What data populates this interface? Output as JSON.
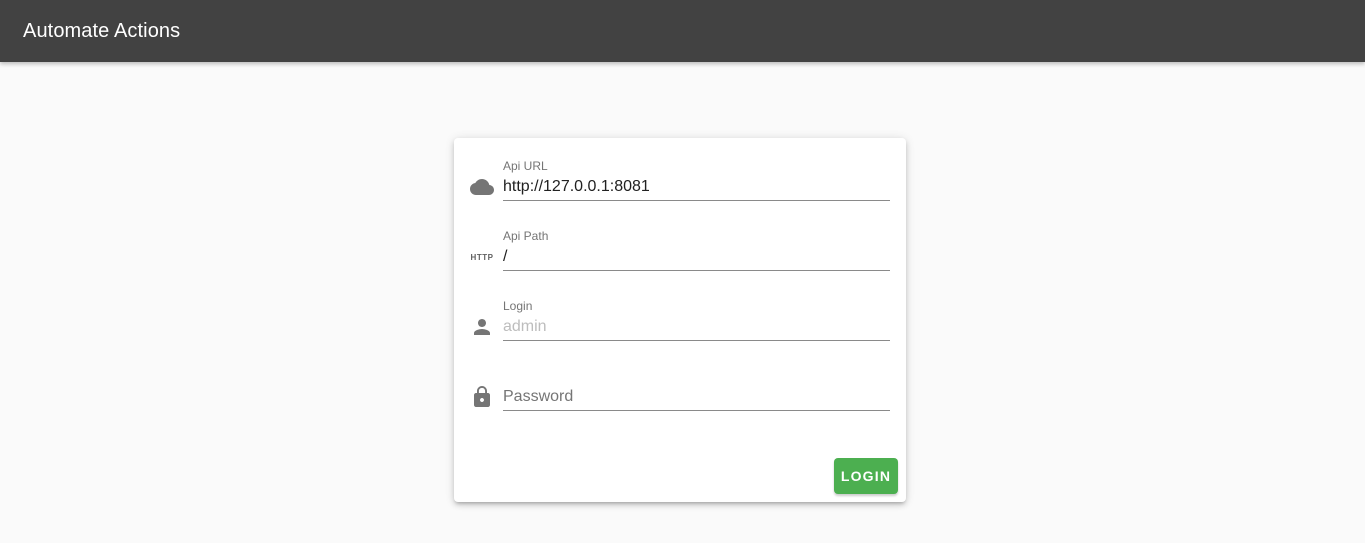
{
  "app": {
    "title": "Automate Actions"
  },
  "form": {
    "api_url": {
      "label": "Api URL",
      "value": "http://127.0.0.1:8081",
      "icon": "cloud-icon"
    },
    "api_path": {
      "label": "Api Path",
      "value": "/",
      "icon": "http-icon",
      "icon_text": "HTTP"
    },
    "login": {
      "label": "Login",
      "placeholder": "admin",
      "value": "",
      "icon": "person-icon"
    },
    "password": {
      "placeholder": "Password",
      "value": "",
      "icon": "lock-icon"
    },
    "submit_label": "LOGIN"
  },
  "colors": {
    "appbar": "#424242",
    "background": "#fafafa",
    "accent": "#4caf50",
    "icon": "#757575"
  }
}
